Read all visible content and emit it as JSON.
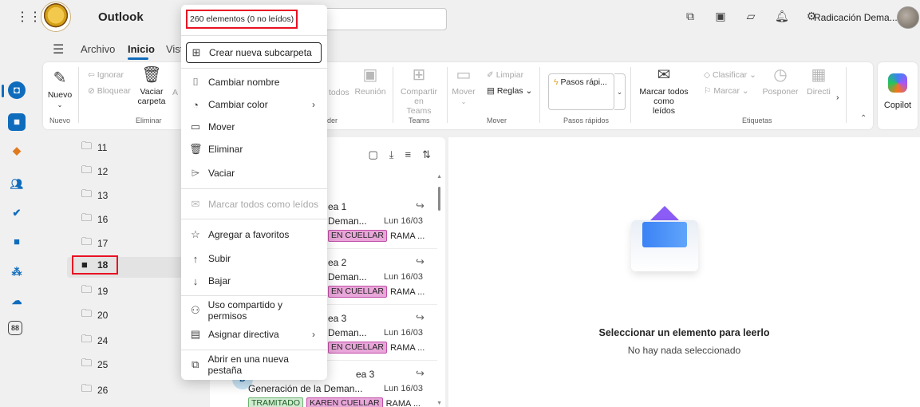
{
  "app": {
    "title": "Outlook",
    "user_name": "Radicación Dema..."
  },
  "top_icons": [
    "meet-now-icon",
    "teams-icon",
    "my-day-icon",
    "bell-icon",
    "gear-icon"
  ],
  "ribbon_tabs": [
    "Archivo",
    "Inicio",
    "Vist"
  ],
  "ribbon": {
    "nuevo": "Nuevo",
    "nuevo_group": "Nuevo",
    "ignorar": "Ignorar",
    "bloquear": "Bloquear",
    "vaciar_1": "Vaciar",
    "vaciar_2": "carpeta",
    "vaciar_partial": "A",
    "eliminar_group": "Eliminar",
    "todos": "todos",
    "reunion": "Reunión",
    "der_group": "der",
    "compartir_1": "Compartir en",
    "compartir_2": "Teams",
    "teams_group": "Teams",
    "limpiar": "Limpiar",
    "reglas": "Reglas",
    "mover": "Mover",
    "mover_group": "Mover",
    "pasos": "Pasos rápi...",
    "pasos_group": "Pasos rápidos",
    "marcar_leidos_1": "Marcar todos como",
    "marcar_leidos_2": "leídos",
    "clasificar": "Clasificar",
    "marcar": "Marcar",
    "posponer": "Posponer",
    "directiva": "Directi",
    "etiquetas_group": "Etiquetas",
    "copilot": "Copilot"
  },
  "folders": [
    "11",
    "12",
    "13",
    "16",
    "17",
    "18",
    "19",
    "20",
    "24",
    "25",
    "26"
  ],
  "selected_folder": "18",
  "context_menu": {
    "count_label": "260 elementos (0 no leídos)",
    "items": [
      {
        "label": "Crear nueva subcarpeta",
        "icon": "folder-add-icon"
      },
      {
        "label": "Cambiar nombre",
        "icon": "rename-icon"
      },
      {
        "label": "Cambiar color",
        "icon": "color-icon"
      },
      {
        "label": "Mover",
        "icon": "folder-move-icon"
      },
      {
        "label": "Eliminar",
        "icon": "trash-icon"
      },
      {
        "label": "Vaciar",
        "icon": "empty-icon"
      },
      {
        "label": "Marcar todos como leídos",
        "icon": "mail-read-icon"
      },
      {
        "label": "Agregar a favoritos",
        "icon": "star-icon"
      },
      {
        "label": "Subir",
        "icon": "arrow-up-icon"
      },
      {
        "label": "Bajar",
        "icon": "arrow-down-icon"
      },
      {
        "label": "Uso compartido y permisos",
        "icon": "people-icon"
      },
      {
        "label": "Asignar directiva",
        "icon": "policy-icon"
      },
      {
        "label": "Abrir en una nueva pestaña",
        "icon": "open-tab-icon"
      }
    ]
  },
  "messages": [
    {
      "subject": "ea 1",
      "preview": "Deman...",
      "date": "Lun 16/03",
      "tag": "EN CUELLAR",
      "extra": "RAMA ..."
    },
    {
      "subject": "ea 2",
      "preview": "Deman...",
      "date": "Lun 16/03",
      "tag": "EN CUELLAR",
      "extra": "RAMA ..."
    },
    {
      "subject": "ea 3",
      "preview": "Deman...",
      "date": "Lun 16/03",
      "tag": "EN CUELLAR",
      "extra": "RAMA ..."
    },
    {
      "subject": "ea 3",
      "preview": "Generación de la Deman...",
      "date": "Lun 16/03",
      "tag0": "TRAMITADO",
      "tag": "KAREN CUELLAR",
      "extra": "RAMA ...",
      "avatar": "D"
    }
  ],
  "reading_pane": {
    "title": "Seleccionar un elemento para leerlo",
    "subtitle": "No hay nada seleccionado"
  },
  "colors": {
    "accent": "#0f6cbd",
    "highlight_outline": "#e81123",
    "tag_pink": "#e8a6d9",
    "tag_green": "#cfead0"
  }
}
